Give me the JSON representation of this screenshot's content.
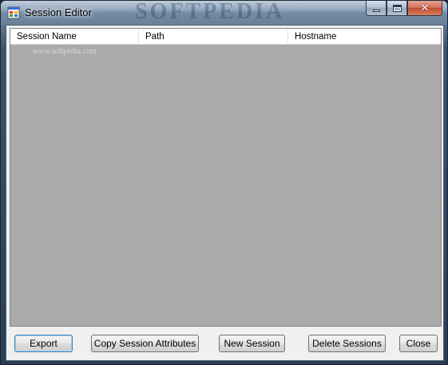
{
  "window": {
    "title": "Session Editor",
    "watermark": "SOFTPEDIA",
    "controls": {
      "minimize_icon": "minimize-icon",
      "maximize_icon": "maximize-icon",
      "close_icon": "close-icon"
    }
  },
  "listview": {
    "columns": [
      "Session Name",
      "Path",
      "Hostname"
    ],
    "rows": [],
    "watermark_url": "www.softpedia.com"
  },
  "buttons": {
    "export": "Export",
    "copy_attributes": "Copy Session Attributes",
    "new_session": "New Session",
    "delete_sessions": "Delete Sessions",
    "close": "Close"
  },
  "colors": {
    "list_background": "#aaaaaa",
    "client_background": "#f0f0f0",
    "close_button": "#c24a30"
  }
}
